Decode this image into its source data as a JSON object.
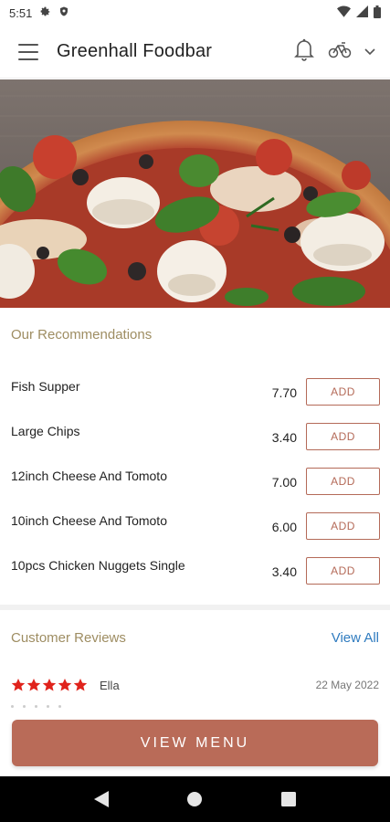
{
  "status_bar": {
    "time": "5:51"
  },
  "app_bar": {
    "title": "Greenhall Foodbar"
  },
  "recommendations": {
    "title": "Our Recommendations",
    "add_label": "ADD",
    "items": [
      {
        "name": "Fish Supper",
        "price": "7.70"
      },
      {
        "name": "Large Chips",
        "price": "3.40"
      },
      {
        "name": "12inch Cheese And Tomoto",
        "price": "7.00"
      },
      {
        "name": "10inch Cheese And Tomoto",
        "price": "6.00"
      },
      {
        "name": "10pcs Chicken Nuggets Single",
        "price": "3.40"
      }
    ]
  },
  "reviews": {
    "title": "Customer Reviews",
    "view_all": "View All",
    "items": [
      {
        "name": "Ella",
        "date": "22 May 2022",
        "rating": 5
      }
    ]
  },
  "cta": {
    "label": "VIEW MENU"
  },
  "colors": {
    "accent": "#b96b58",
    "section_title": "#9e8d62",
    "link": "#2f7bbf",
    "star": "#e0231c"
  },
  "icons": [
    "settings-icon",
    "shield-icon",
    "wifi-icon",
    "signal-icon",
    "battery-icon",
    "menu-icon",
    "bell-icon",
    "bicycle-icon",
    "chevron-down-icon",
    "back-icon",
    "home-icon",
    "recents-icon"
  ]
}
